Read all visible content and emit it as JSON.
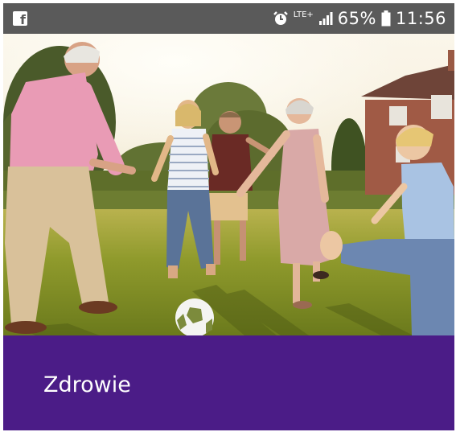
{
  "status_bar": {
    "app_icon": "facebook-icon",
    "alarm_icon": "alarm-clock-icon",
    "network": "LTE+",
    "signal_icon": "signal-bars-icon",
    "battery_percent": "65%",
    "battery_icon": "battery-icon",
    "time": "11:56"
  },
  "hero": {
    "image_subject": "family-playing-football-photo"
  },
  "card": {
    "title": "Zdrowie",
    "background_color": "#4b1c87"
  }
}
